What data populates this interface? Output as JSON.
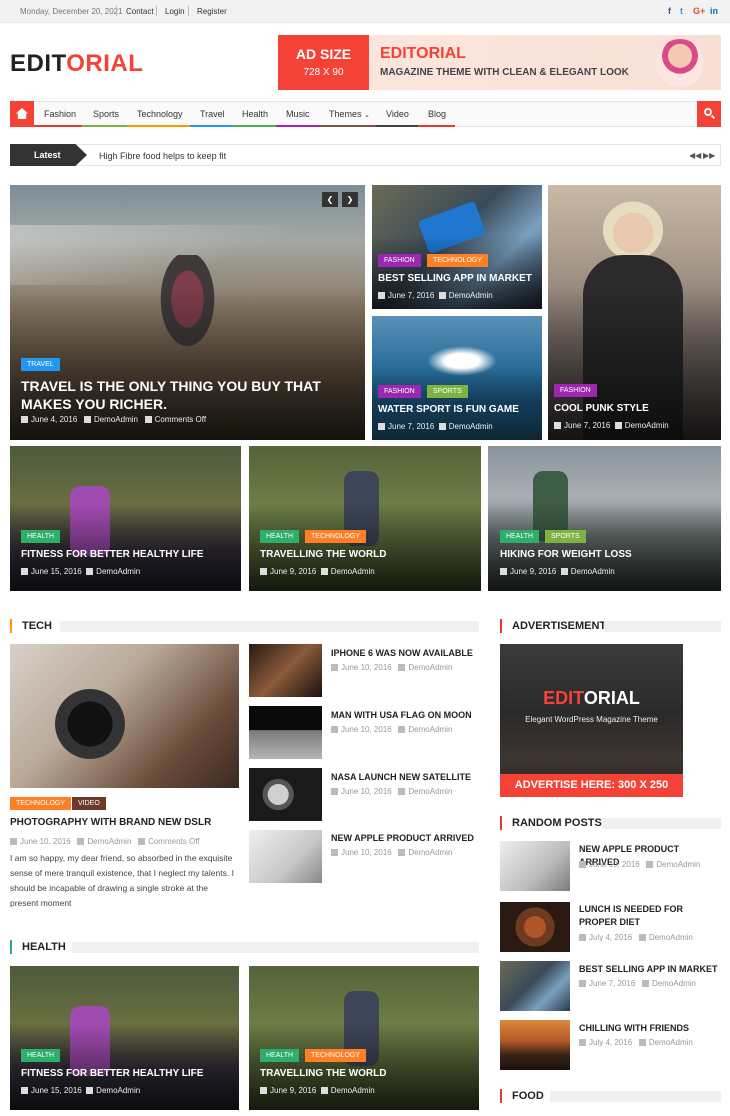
{
  "topbar": {
    "date": "Monday, December 20, 2021",
    "links": [
      "Contact",
      "Login",
      "Register"
    ],
    "social": [
      "f",
      "t",
      "G+",
      "in"
    ]
  },
  "logo": {
    "part1": "EDIT",
    "part2": "ORIAL"
  },
  "ad_banner": {
    "size_title": "AD SIZE",
    "size_dims": "728 X 90",
    "title": "EDITORIAL",
    "subtitle": "MAGAZINE THEME WITH CLEAN & ELEGANT LOOK"
  },
  "nav": {
    "items": [
      "Fashion",
      "Sports",
      "Technology",
      "Travel",
      "Health",
      "Music",
      "Themes",
      "Video",
      "Blog"
    ],
    "underline_colors": [
      "#e53935",
      "#7cb342",
      "#ff9800",
      "#2196f3",
      "#4caf50",
      "#9c27b0",
      "#795548",
      "#424242",
      "#e53935"
    ],
    "dropdown_icon": "chevron-down-icon"
  },
  "ticker": {
    "label": "Latest",
    "text": "High Fibre food helps to keep fit"
  },
  "featured": {
    "main": {
      "category": "TRAVEL",
      "title": "TRAVEL IS THE ONLY THING YOU BUY THAT MAKES YOU RICHER.",
      "date": "June 4, 2016",
      "author": "DemoAdmin",
      "comments": "Comments Off"
    },
    "tiles": [
      {
        "cats": [
          "FASHION",
          "TECHNOLOGY"
        ],
        "title": "BEST SELLING APP IN MARKET",
        "date": "June 7, 2016",
        "author": "DemoAdmin"
      },
      {
        "cats": [
          "FASHION",
          "SPORTS"
        ],
        "title": "WATER SPORT IS FUN GAME",
        "date": "June 7, 2016",
        "author": "DemoAdmin"
      },
      {
        "cats": [
          "FASHION"
        ],
        "title": "COOL PUNK STYLE",
        "date": "June 7, 2016",
        "author": "DemoAdmin"
      }
    ],
    "row2": [
      {
        "cats": [
          "HEALTH"
        ],
        "title": "FITNESS FOR BETTER HEALTHY LIFE",
        "date": "June 15, 2016",
        "author": "DemoAdmin"
      },
      {
        "cats": [
          "HEALTH",
          "TECHNOLOGY"
        ],
        "title": "TRAVELLING THE WORLD",
        "date": "June 9, 2016",
        "author": "DemoAdmin"
      },
      {
        "cats": [
          "HEALTH",
          "SPORTS"
        ],
        "title": "HIKING FOR WEIGHT LOSS",
        "date": "June 9, 2016",
        "author": "DemoAdmin"
      }
    ]
  },
  "tech": {
    "heading": "TECH",
    "main": {
      "cats": [
        "TECHNOLOGY",
        "VIDEO"
      ],
      "title": "PHOTOGRAPHY WITH BRAND NEW DSLR",
      "date": "June 10, 2016",
      "author": "DemoAdmin",
      "comments": "Comments Off",
      "excerpt": "I am so happy, my dear friend, so absorbed in the exquisite sense of mere tranquil existence, that I neglect my talents. I should be incapable of drawing a single stroke at the present moment"
    },
    "list": [
      {
        "title": "IPHONE 6 WAS NOW AVAILABLE",
        "date": "June 10, 2016",
        "author": "DemoAdmin"
      },
      {
        "title": "MAN WITH USA FLAG ON MOON",
        "date": "June 10, 2016",
        "author": "DemoAdmin"
      },
      {
        "title": "NASA LAUNCH NEW SATELLITE",
        "date": "June 10, 2016",
        "author": "DemoAdmin"
      },
      {
        "title": "NEW APPLE PRODUCT ARRIVED",
        "date": "June 10, 2016",
        "author": "DemoAdmin"
      }
    ]
  },
  "health": {
    "heading": "HEALTH",
    "items": [
      {
        "cats": [
          "HEALTH"
        ],
        "title": "FITNESS FOR BETTER HEALTHY LIFE",
        "date": "June 15, 2016",
        "author": "DemoAdmin"
      },
      {
        "cats": [
          "HEALTH",
          "TECHNOLOGY"
        ],
        "title": "TRAVELLING THE WORLD",
        "date": "June 9, 2016",
        "author": "DemoAdmin"
      }
    ]
  },
  "sidebar": {
    "advert_heading": "ADVERTISEMENT",
    "advert": {
      "logo1": "EDIT",
      "logo2": "ORIAL",
      "tagline": "Elegant WordPress Magazine Theme",
      "cta": "ADVERTISE HERE: 300 X 250"
    },
    "random_heading": "RANDOM POSTS",
    "random": [
      {
        "title": "NEW APPLE PRODUCT ARRIVED",
        "date": "June 10, 2016",
        "author": "DemoAdmin"
      },
      {
        "title": "LUNCH IS NEEDED FOR PROPER DIET",
        "date": "July 4, 2016",
        "author": "DemoAdmin"
      },
      {
        "title": "BEST SELLING APP IN MARKET",
        "date": "June 7, 2016",
        "author": "DemoAdmin"
      },
      {
        "title": "CHILLING WITH FRIENDS",
        "date": "July 4, 2016",
        "author": "DemoAdmin"
      }
    ],
    "food_heading": "FOOD"
  },
  "category_colors": {
    "TRAVEL": "#2196f3",
    "FASHION": "#9c27b0",
    "TECHNOLOGY": "#ff7f27",
    "SPORTS": "#7cb342",
    "HEALTH": "#2eae6b",
    "VIDEO": "#6d3a2a"
  }
}
